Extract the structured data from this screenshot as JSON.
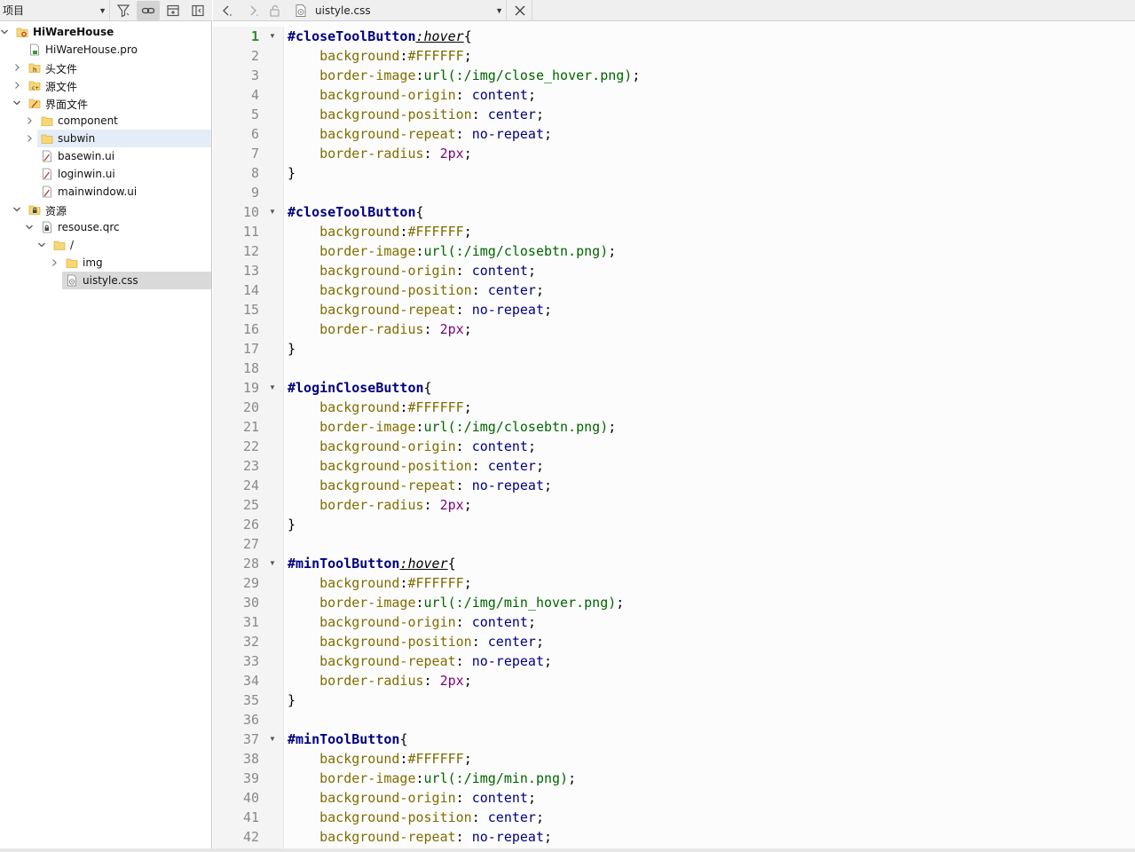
{
  "project_panel": {
    "view_selector": "项目",
    "tree": [
      {
        "label": "HiWareHouse",
        "depth": 0,
        "expanded": true,
        "icon": "qt-project-icon",
        "bold": true
      },
      {
        "label": "HiWareHouse.pro",
        "depth": 1,
        "icon": "pro-file-icon"
      },
      {
        "label": "头文件",
        "depth": 1,
        "expanded": false,
        "icon": "headers-folder-icon"
      },
      {
        "label": "源文件",
        "depth": 1,
        "expanded": false,
        "icon": "sources-folder-icon"
      },
      {
        "label": "界面文件",
        "depth": 1,
        "expanded": true,
        "icon": "forms-folder-icon"
      },
      {
        "label": "component",
        "depth": 2,
        "expanded": false,
        "icon": "folder-icon"
      },
      {
        "label": "subwin",
        "depth": 2,
        "expanded": false,
        "icon": "folder-icon",
        "hover": true
      },
      {
        "label": "basewin.ui",
        "depth": 2,
        "icon": "ui-file-icon"
      },
      {
        "label": "loginwin.ui",
        "depth": 2,
        "icon": "ui-file-icon"
      },
      {
        "label": "mainwindow.ui",
        "depth": 2,
        "icon": "ui-file-icon"
      },
      {
        "label": "资源",
        "depth": 1,
        "expanded": true,
        "icon": "resources-folder-icon"
      },
      {
        "label": "resouse.qrc",
        "depth": 2,
        "expanded": true,
        "icon": "qrc-file-icon"
      },
      {
        "label": "/",
        "depth": 3,
        "expanded": true,
        "icon": "folder-icon"
      },
      {
        "label": "img",
        "depth": 4,
        "expanded": false,
        "icon": "folder-icon"
      },
      {
        "label": "uistyle.css",
        "depth": 4,
        "icon": "css-file-icon",
        "selected": true
      }
    ]
  },
  "editor": {
    "open_file": "uistyle.css",
    "current_line": 1,
    "lines": [
      {
        "n": 1,
        "fold": true,
        "tokens": [
          [
            "sel",
            "#closeToolButton"
          ],
          [
            "pseudo",
            ":hover"
          ],
          [
            "pun",
            "{"
          ]
        ]
      },
      {
        "n": 2,
        "tokens": [
          [
            "pun",
            "    "
          ],
          [
            "prop",
            "background"
          ],
          [
            "pun",
            ":"
          ],
          [
            "prop",
            "#FFFFFF"
          ],
          [
            "pun",
            ";"
          ]
        ]
      },
      {
        "n": 3,
        "tokens": [
          [
            "pun",
            "    "
          ],
          [
            "prop",
            "border-image"
          ],
          [
            "pun",
            ":"
          ],
          [
            "func",
            "url(:/img/close_hover.png)"
          ],
          [
            "pun",
            ";"
          ]
        ]
      },
      {
        "n": 4,
        "tokens": [
          [
            "pun",
            "    "
          ],
          [
            "prop",
            "background-origin"
          ],
          [
            "pun",
            ": "
          ],
          [
            "val",
            "content"
          ],
          [
            "pun",
            ";"
          ]
        ]
      },
      {
        "n": 5,
        "tokens": [
          [
            "pun",
            "    "
          ],
          [
            "prop",
            "background-position"
          ],
          [
            "pun",
            ": "
          ],
          [
            "val",
            "center"
          ],
          [
            "pun",
            ";"
          ]
        ]
      },
      {
        "n": 6,
        "tokens": [
          [
            "pun",
            "    "
          ],
          [
            "prop",
            "background-repeat"
          ],
          [
            "pun",
            ": "
          ],
          [
            "val",
            "no-repeat"
          ],
          [
            "pun",
            ";"
          ]
        ]
      },
      {
        "n": 7,
        "tokens": [
          [
            "pun",
            "    "
          ],
          [
            "prop",
            "border-radius"
          ],
          [
            "pun",
            ": "
          ],
          [
            "num",
            "2px"
          ],
          [
            "pun",
            ";"
          ]
        ]
      },
      {
        "n": 8,
        "tokens": [
          [
            "pun",
            "}"
          ]
        ]
      },
      {
        "n": 9,
        "tokens": []
      },
      {
        "n": 10,
        "fold": true,
        "tokens": [
          [
            "sel",
            "#closeToolButton"
          ],
          [
            "pun",
            "{"
          ]
        ]
      },
      {
        "n": 11,
        "tokens": [
          [
            "pun",
            "    "
          ],
          [
            "prop",
            "background"
          ],
          [
            "pun",
            ":"
          ],
          [
            "prop",
            "#FFFFFF"
          ],
          [
            "pun",
            ";"
          ]
        ]
      },
      {
        "n": 12,
        "tokens": [
          [
            "pun",
            "    "
          ],
          [
            "prop",
            "border-image"
          ],
          [
            "pun",
            ":"
          ],
          [
            "func",
            "url(:/img/closebtn.png)"
          ],
          [
            "pun",
            ";"
          ]
        ]
      },
      {
        "n": 13,
        "tokens": [
          [
            "pun",
            "    "
          ],
          [
            "prop",
            "background-origin"
          ],
          [
            "pun",
            ": "
          ],
          [
            "val",
            "content"
          ],
          [
            "pun",
            ";"
          ]
        ]
      },
      {
        "n": 14,
        "tokens": [
          [
            "pun",
            "    "
          ],
          [
            "prop",
            "background-position"
          ],
          [
            "pun",
            ": "
          ],
          [
            "val",
            "center"
          ],
          [
            "pun",
            ";"
          ]
        ]
      },
      {
        "n": 15,
        "tokens": [
          [
            "pun",
            "    "
          ],
          [
            "prop",
            "background-repeat"
          ],
          [
            "pun",
            ": "
          ],
          [
            "val",
            "no-repeat"
          ],
          [
            "pun",
            ";"
          ]
        ]
      },
      {
        "n": 16,
        "tokens": [
          [
            "pun",
            "    "
          ],
          [
            "prop",
            "border-radius"
          ],
          [
            "pun",
            ": "
          ],
          [
            "num",
            "2px"
          ],
          [
            "pun",
            ";"
          ]
        ]
      },
      {
        "n": 17,
        "tokens": [
          [
            "pun",
            "}"
          ]
        ]
      },
      {
        "n": 18,
        "tokens": []
      },
      {
        "n": 19,
        "fold": true,
        "tokens": [
          [
            "sel",
            "#loginCloseButton"
          ],
          [
            "pun",
            "{"
          ]
        ]
      },
      {
        "n": 20,
        "tokens": [
          [
            "pun",
            "    "
          ],
          [
            "prop",
            "background"
          ],
          [
            "pun",
            ":"
          ],
          [
            "prop",
            "#FFFFFF"
          ],
          [
            "pun",
            ";"
          ]
        ]
      },
      {
        "n": 21,
        "tokens": [
          [
            "pun",
            "    "
          ],
          [
            "prop",
            "border-image"
          ],
          [
            "pun",
            ":"
          ],
          [
            "func",
            "url(:/img/closebtn.png)"
          ],
          [
            "pun",
            ";"
          ]
        ]
      },
      {
        "n": 22,
        "tokens": [
          [
            "pun",
            "    "
          ],
          [
            "prop",
            "background-origin"
          ],
          [
            "pun",
            ": "
          ],
          [
            "val",
            "content"
          ],
          [
            "pun",
            ";"
          ]
        ]
      },
      {
        "n": 23,
        "tokens": [
          [
            "pun",
            "    "
          ],
          [
            "prop",
            "background-position"
          ],
          [
            "pun",
            ": "
          ],
          [
            "val",
            "center"
          ],
          [
            "pun",
            ";"
          ]
        ]
      },
      {
        "n": 24,
        "tokens": [
          [
            "pun",
            "    "
          ],
          [
            "prop",
            "background-repeat"
          ],
          [
            "pun",
            ": "
          ],
          [
            "val",
            "no-repeat"
          ],
          [
            "pun",
            ";"
          ]
        ]
      },
      {
        "n": 25,
        "tokens": [
          [
            "pun",
            "    "
          ],
          [
            "prop",
            "border-radius"
          ],
          [
            "pun",
            ": "
          ],
          [
            "num",
            "2px"
          ],
          [
            "pun",
            ";"
          ]
        ]
      },
      {
        "n": 26,
        "tokens": [
          [
            "pun",
            "}"
          ]
        ]
      },
      {
        "n": 27,
        "tokens": []
      },
      {
        "n": 28,
        "fold": true,
        "tokens": [
          [
            "sel",
            "#minToolButton"
          ],
          [
            "pseudo",
            ":hover"
          ],
          [
            "pun",
            "{"
          ]
        ]
      },
      {
        "n": 29,
        "tokens": [
          [
            "pun",
            "    "
          ],
          [
            "prop",
            "background"
          ],
          [
            "pun",
            ":"
          ],
          [
            "prop",
            "#FFFFFF"
          ],
          [
            "pun",
            ";"
          ]
        ]
      },
      {
        "n": 30,
        "tokens": [
          [
            "pun",
            "    "
          ],
          [
            "prop",
            "border-image"
          ],
          [
            "pun",
            ":"
          ],
          [
            "func",
            "url(:/img/min_hover.png)"
          ],
          [
            "pun",
            ";"
          ]
        ]
      },
      {
        "n": 31,
        "tokens": [
          [
            "pun",
            "    "
          ],
          [
            "prop",
            "background-origin"
          ],
          [
            "pun",
            ": "
          ],
          [
            "val",
            "content"
          ],
          [
            "pun",
            ";"
          ]
        ]
      },
      {
        "n": 32,
        "tokens": [
          [
            "pun",
            "    "
          ],
          [
            "prop",
            "background-position"
          ],
          [
            "pun",
            ": "
          ],
          [
            "val",
            "center"
          ],
          [
            "pun",
            ";"
          ]
        ]
      },
      {
        "n": 33,
        "tokens": [
          [
            "pun",
            "    "
          ],
          [
            "prop",
            "background-repeat"
          ],
          [
            "pun",
            ": "
          ],
          [
            "val",
            "no-repeat"
          ],
          [
            "pun",
            ";"
          ]
        ]
      },
      {
        "n": 34,
        "tokens": [
          [
            "pun",
            "    "
          ],
          [
            "prop",
            "border-radius"
          ],
          [
            "pun",
            ": "
          ],
          [
            "num",
            "2px"
          ],
          [
            "pun",
            ";"
          ]
        ]
      },
      {
        "n": 35,
        "tokens": [
          [
            "pun",
            "}"
          ]
        ]
      },
      {
        "n": 36,
        "tokens": []
      },
      {
        "n": 37,
        "fold": true,
        "tokens": [
          [
            "sel",
            "#minToolButton"
          ],
          [
            "pun",
            "{"
          ]
        ]
      },
      {
        "n": 38,
        "tokens": [
          [
            "pun",
            "    "
          ],
          [
            "prop",
            "background"
          ],
          [
            "pun",
            ":"
          ],
          [
            "prop",
            "#FFFFFF"
          ],
          [
            "pun",
            ";"
          ]
        ]
      },
      {
        "n": 39,
        "tokens": [
          [
            "pun",
            "    "
          ],
          [
            "prop",
            "border-image"
          ],
          [
            "pun",
            ":"
          ],
          [
            "func",
            "url(:/img/min.png)"
          ],
          [
            "pun",
            ";"
          ]
        ]
      },
      {
        "n": 40,
        "tokens": [
          [
            "pun",
            "    "
          ],
          [
            "prop",
            "background-origin"
          ],
          [
            "pun",
            ": "
          ],
          [
            "val",
            "content"
          ],
          [
            "pun",
            ";"
          ]
        ]
      },
      {
        "n": 41,
        "tokens": [
          [
            "pun",
            "    "
          ],
          [
            "prop",
            "background-position"
          ],
          [
            "pun",
            ": "
          ],
          [
            "val",
            "center"
          ],
          [
            "pun",
            ";"
          ]
        ]
      },
      {
        "n": 42,
        "tokens": [
          [
            "pun",
            "    "
          ],
          [
            "prop",
            "background-repeat"
          ],
          [
            "pun",
            ": "
          ],
          [
            "val",
            "no-repeat"
          ],
          [
            "pun",
            ";"
          ]
        ]
      }
    ]
  }
}
